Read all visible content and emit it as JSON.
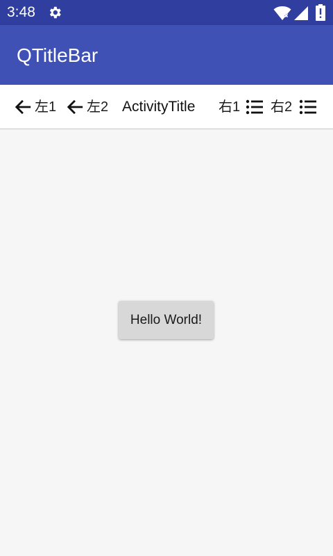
{
  "status_bar": {
    "time": "3:48",
    "icons": [
      "gear-icon",
      "wifi-icon",
      "cell-signal-icon",
      "battery-icon"
    ]
  },
  "app_bar": {
    "title": "QTitleBar",
    "color": "#3f51b5"
  },
  "title_bar": {
    "left_items": [
      {
        "icon": "back-arrow-icon",
        "label": "左1"
      },
      {
        "icon": "back-arrow-icon",
        "label": "左2"
      }
    ],
    "title": "ActivityTitle",
    "right_items": [
      {
        "label": "右1",
        "icon": "list-icon"
      },
      {
        "label": "右2",
        "icon": "list-icon"
      }
    ]
  },
  "main": {
    "button_label": "Hello World!"
  },
  "colors": {
    "status_bar": "#303f9f",
    "app_bar": "#3f51b5",
    "background": "#f6f6f6"
  }
}
